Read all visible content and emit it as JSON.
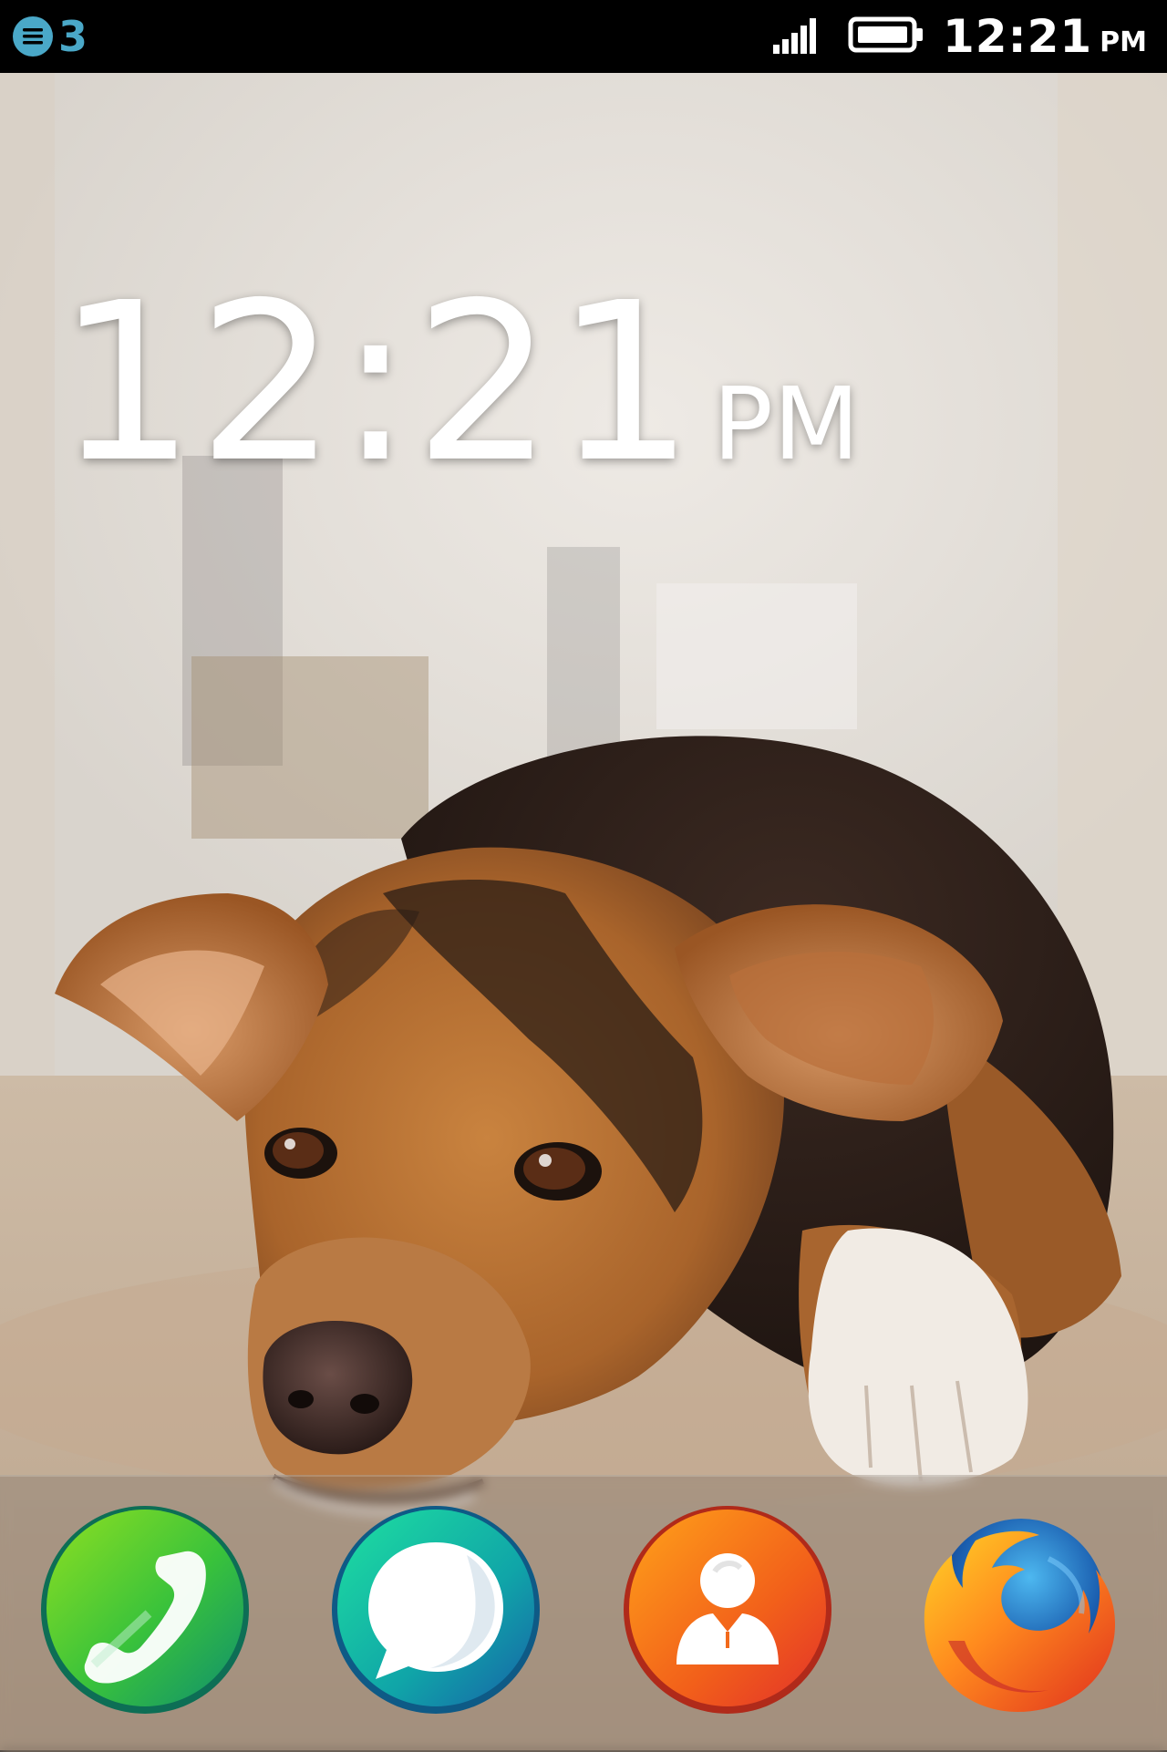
{
  "status_bar": {
    "notification_count": "3",
    "notification_icon": "notification-list-icon",
    "signal_icon": "signal-bars-icon",
    "battery_icon": "battery-full-icon",
    "time": "12:21",
    "ampm": "PM"
  },
  "lockscreen_clock": {
    "time": "12:21",
    "ampm": "PM"
  },
  "dock": {
    "apps": [
      {
        "icon": "phone-icon",
        "accent": "#4cc82a"
      },
      {
        "icon": "messages-icon",
        "accent": "#1bb3a6"
      },
      {
        "icon": "contacts-icon",
        "accent": "#f26a1b"
      },
      {
        "icon": "browser-icon",
        "accent": "#e8562a"
      }
    ]
  }
}
